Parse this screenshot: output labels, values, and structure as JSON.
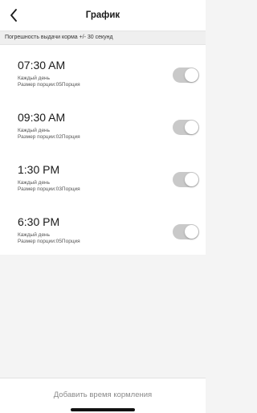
{
  "header": {
    "title": "График",
    "back_icon": "chevron-left-icon"
  },
  "note": "Погрешность выдачи корма +/- 30 секунд",
  "schedule": [
    {
      "time": "07:30 AM",
      "frequency": "Каждый день",
      "portion": "Размер порции:05Порция",
      "enabled": true
    },
    {
      "time": "09:30 AM",
      "frequency": "Каждый день",
      "portion": "Размер порции:02Порция",
      "enabled": true
    },
    {
      "time": "1:30 PM",
      "frequency": "Каждый день",
      "portion": "Размер порции:03Порция",
      "enabled": true
    },
    {
      "time": "6:30 PM",
      "frequency": "Каждый день",
      "portion": "Размер порции:05Порция",
      "enabled": true
    }
  ],
  "footer": {
    "add_label": "Добавить время кормления"
  },
  "colors": {
    "toggle_track": "#c9c9c9",
    "toggle_knob": "#ffffff",
    "background": "#f4f4f4"
  }
}
